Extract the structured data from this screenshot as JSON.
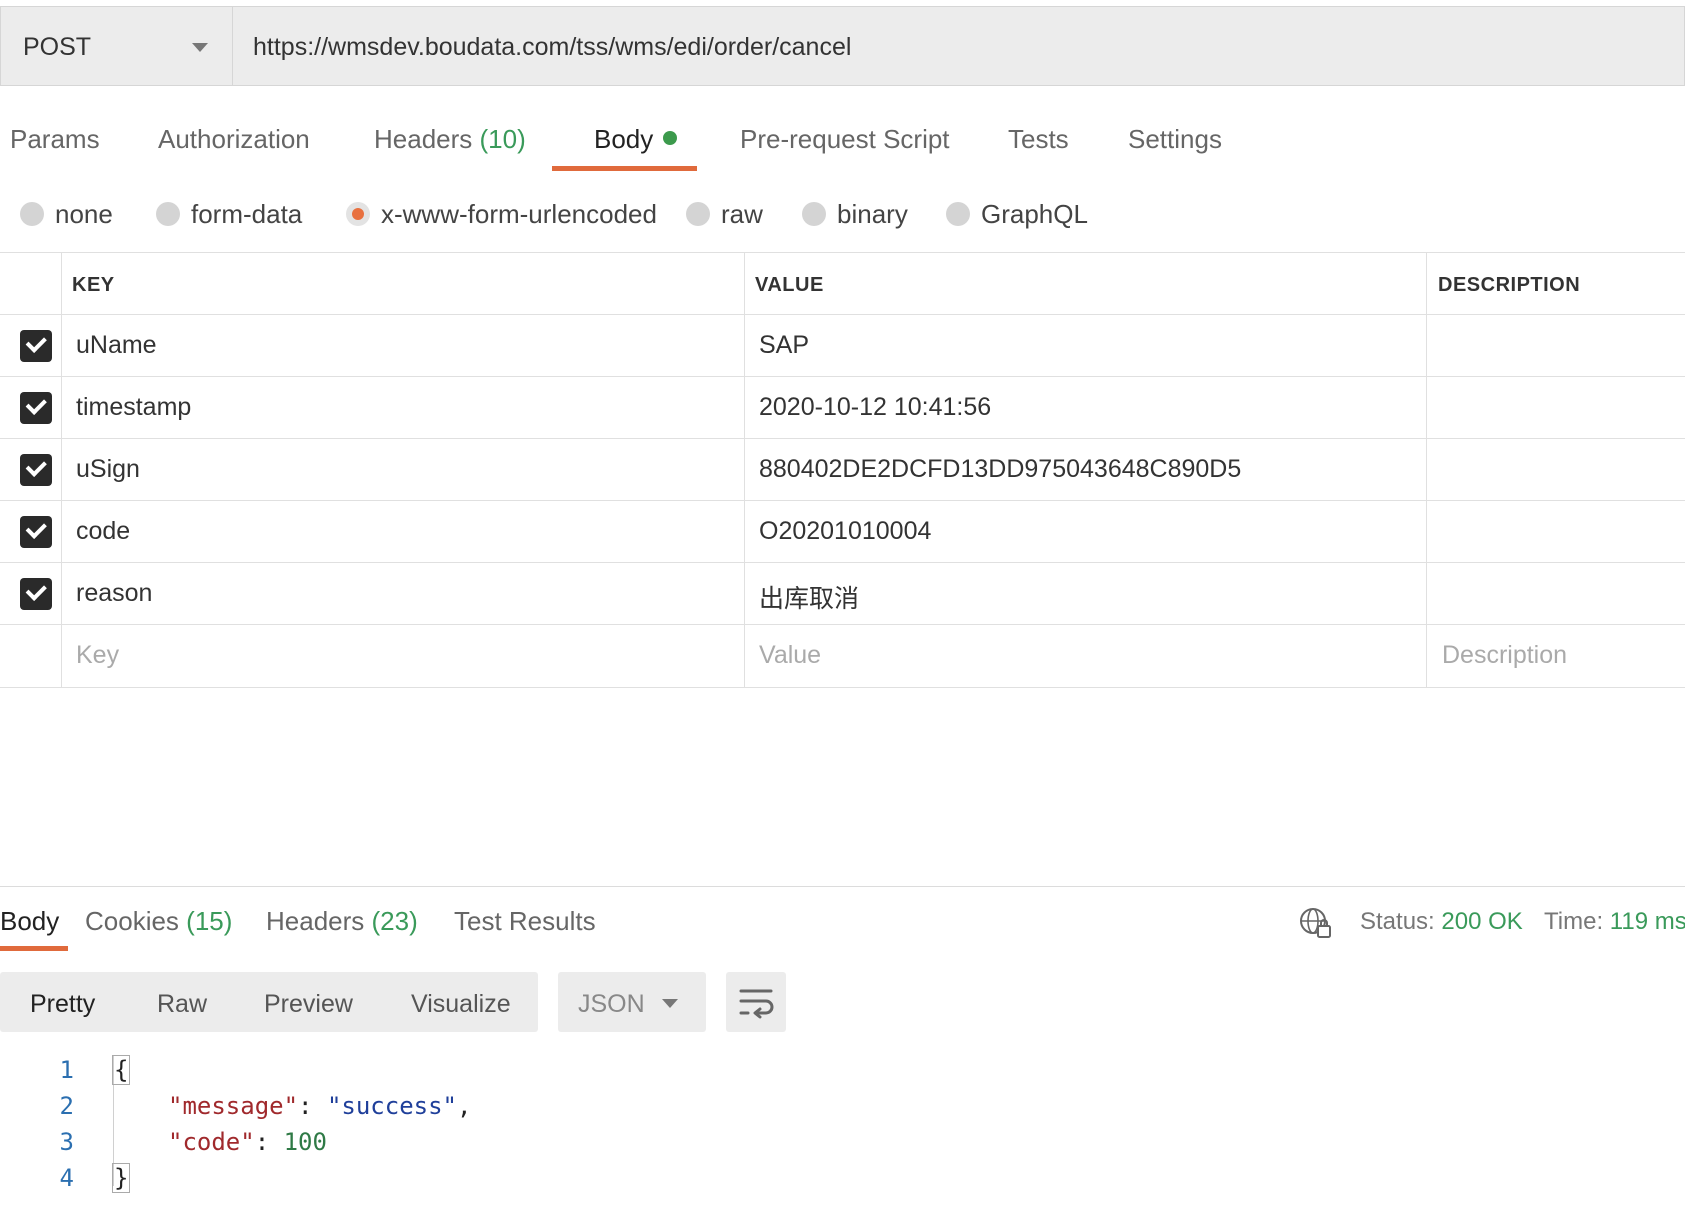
{
  "request": {
    "method": "POST",
    "url": "https://wmsdev.boudata.com/tss/wms/edi/order/cancel"
  },
  "request_tabs": {
    "params": "Params",
    "authorization": "Authorization",
    "headers": "Headers",
    "headers_count": "(10)",
    "body": "Body",
    "prerequest": "Pre-request Script",
    "tests": "Tests",
    "settings": "Settings"
  },
  "body_types": {
    "none": "none",
    "form_data": "form-data",
    "urlencoded": "x-www-form-urlencoded",
    "raw": "raw",
    "binary": "binary",
    "graphql": "GraphQL",
    "selected": "x-www-form-urlencoded"
  },
  "table": {
    "headers": {
      "key": "KEY",
      "value": "VALUE",
      "description": "DESCRIPTION"
    },
    "rows": [
      {
        "key": "uName",
        "value": "SAP",
        "checked": true
      },
      {
        "key": "timestamp",
        "value": "2020-10-12 10:41:56",
        "checked": true
      },
      {
        "key": "uSign",
        "value": "880402DE2DCFD13DD975043648C890D5",
        "checked": true
      },
      {
        "key": "code",
        "value": "O20201010004",
        "checked": true
      },
      {
        "key": "reason",
        "value": "出库取消",
        "checked": true
      }
    ],
    "placeholders": {
      "key": "Key",
      "value": "Value",
      "description": "Description"
    }
  },
  "response_tabs": {
    "body": "Body",
    "cookies": "Cookies",
    "cookies_count": "(15)",
    "headers": "Headers",
    "headers_count": "(23)",
    "test_results": "Test Results"
  },
  "response_status": {
    "status_label": "Status:",
    "status_value": "200 OK",
    "time_label": "Time:",
    "time_value": "119 ms"
  },
  "view_modes": {
    "pretty": "Pretty",
    "raw": "Raw",
    "preview": "Preview",
    "visualize": "Visualize",
    "format": "JSON"
  },
  "response_body": {
    "line_numbers": [
      "1",
      "2",
      "3",
      "4"
    ],
    "open_brace": "{",
    "close_brace": "}",
    "message_key": "\"message\"",
    "message_value": "\"success\"",
    "code_key": "\"code\"",
    "code_value": "100",
    "colon": ": ",
    "comma": ","
  },
  "colors": {
    "accent": "#e06a3c",
    "count_green": "#3a9a5a",
    "json_key": "#a0292c",
    "json_string": "#1f3f9a",
    "json_number": "#2f7a46"
  }
}
